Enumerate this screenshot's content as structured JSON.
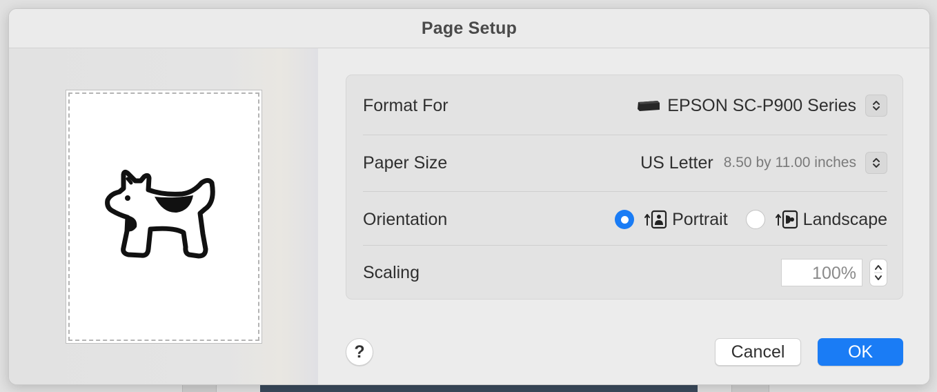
{
  "window": {
    "title": "Page Setup"
  },
  "format_for": {
    "label": "Format For",
    "value": "EPSON SC-P900 Series",
    "icon": "printer-icon"
  },
  "paper_size": {
    "label": "Paper Size",
    "value": "US Letter",
    "dimensions": "8.50 by 11.00 inches"
  },
  "orientation": {
    "label": "Orientation",
    "options": [
      {
        "label": "Portrait",
        "selected": true,
        "icon": "portrait-orientation-icon"
      },
      {
        "label": "Landscape",
        "selected": false,
        "icon": "landscape-orientation-icon"
      }
    ]
  },
  "scaling": {
    "label": "Scaling",
    "value": "100%"
  },
  "buttons": {
    "help": "?",
    "cancel": "Cancel",
    "ok": "OK"
  },
  "preview": {
    "icon": "dogcow-icon"
  },
  "colors": {
    "accent": "#1a7cf5",
    "sheet_bg": "#ececec",
    "group_bg": "#e3e3e3"
  }
}
